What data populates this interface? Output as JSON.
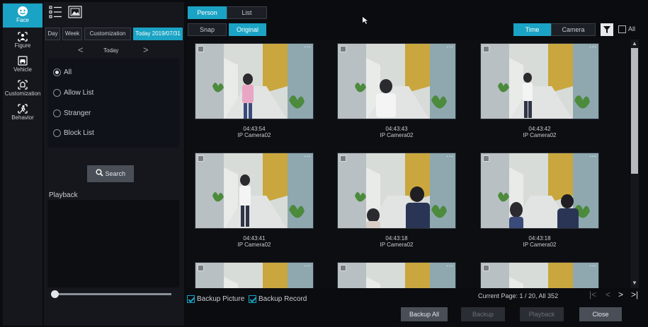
{
  "sidebar": {
    "items": [
      {
        "label": "Face",
        "icon": "face-icon",
        "active": true
      },
      {
        "label": "Figure",
        "icon": "figure-icon"
      },
      {
        "label": "Vehicle",
        "icon": "vehicle-icon"
      },
      {
        "label": "Customization",
        "icon": "customization-icon"
      },
      {
        "label": "Behavior",
        "icon": "behavior-icon"
      }
    ]
  },
  "filter": {
    "view_icons": [
      "list-view-icon",
      "image-view-icon"
    ],
    "date_tabs": [
      "Day",
      "Week",
      "Customization",
      "Today 2019/07/31"
    ],
    "active_date_tab": "Today 2019/07/31",
    "date_nav": {
      "prev": "<",
      "label": "Today",
      "next": ">"
    },
    "types": [
      "All",
      "Allow List",
      "Stranger",
      "Block List"
    ],
    "selected_type": "All",
    "search_label": "Search",
    "playback_label": "Playback"
  },
  "toolbar": {
    "mode_tabs": [
      "Person",
      "List"
    ],
    "active_mode": "Person",
    "image_tabs": [
      "Snap",
      "Original"
    ],
    "active_image": "Original",
    "sort_tabs": [
      "Time",
      "Camera"
    ],
    "active_sort": "Time",
    "all_label": "All"
  },
  "results": [
    {
      "time": "04:43:54",
      "camera": "IP Camera02"
    },
    {
      "time": "04:43:43",
      "camera": "IP Camera02"
    },
    {
      "time": "04:43:42",
      "camera": "IP Camera02"
    },
    {
      "time": "04:43:41",
      "camera": "IP Camera02"
    },
    {
      "time": "04:43:18",
      "camera": "IP Camera02"
    },
    {
      "time": "04:43:18",
      "camera": "IP Camera02"
    },
    {
      "time": "",
      "camera": ""
    },
    {
      "time": "",
      "camera": ""
    },
    {
      "time": "",
      "camera": ""
    }
  ],
  "bottom": {
    "backup_picture": "Backup Picture",
    "backup_record": "Backup Record",
    "page_info": "Current Page: 1 / 20, All 352",
    "buttons": [
      "Backup All",
      "Backup",
      "Playback",
      "Close"
    ]
  },
  "colors": {
    "accent": "#1aa3c4",
    "background": "#0b0c10",
    "panel": "#15171c"
  }
}
